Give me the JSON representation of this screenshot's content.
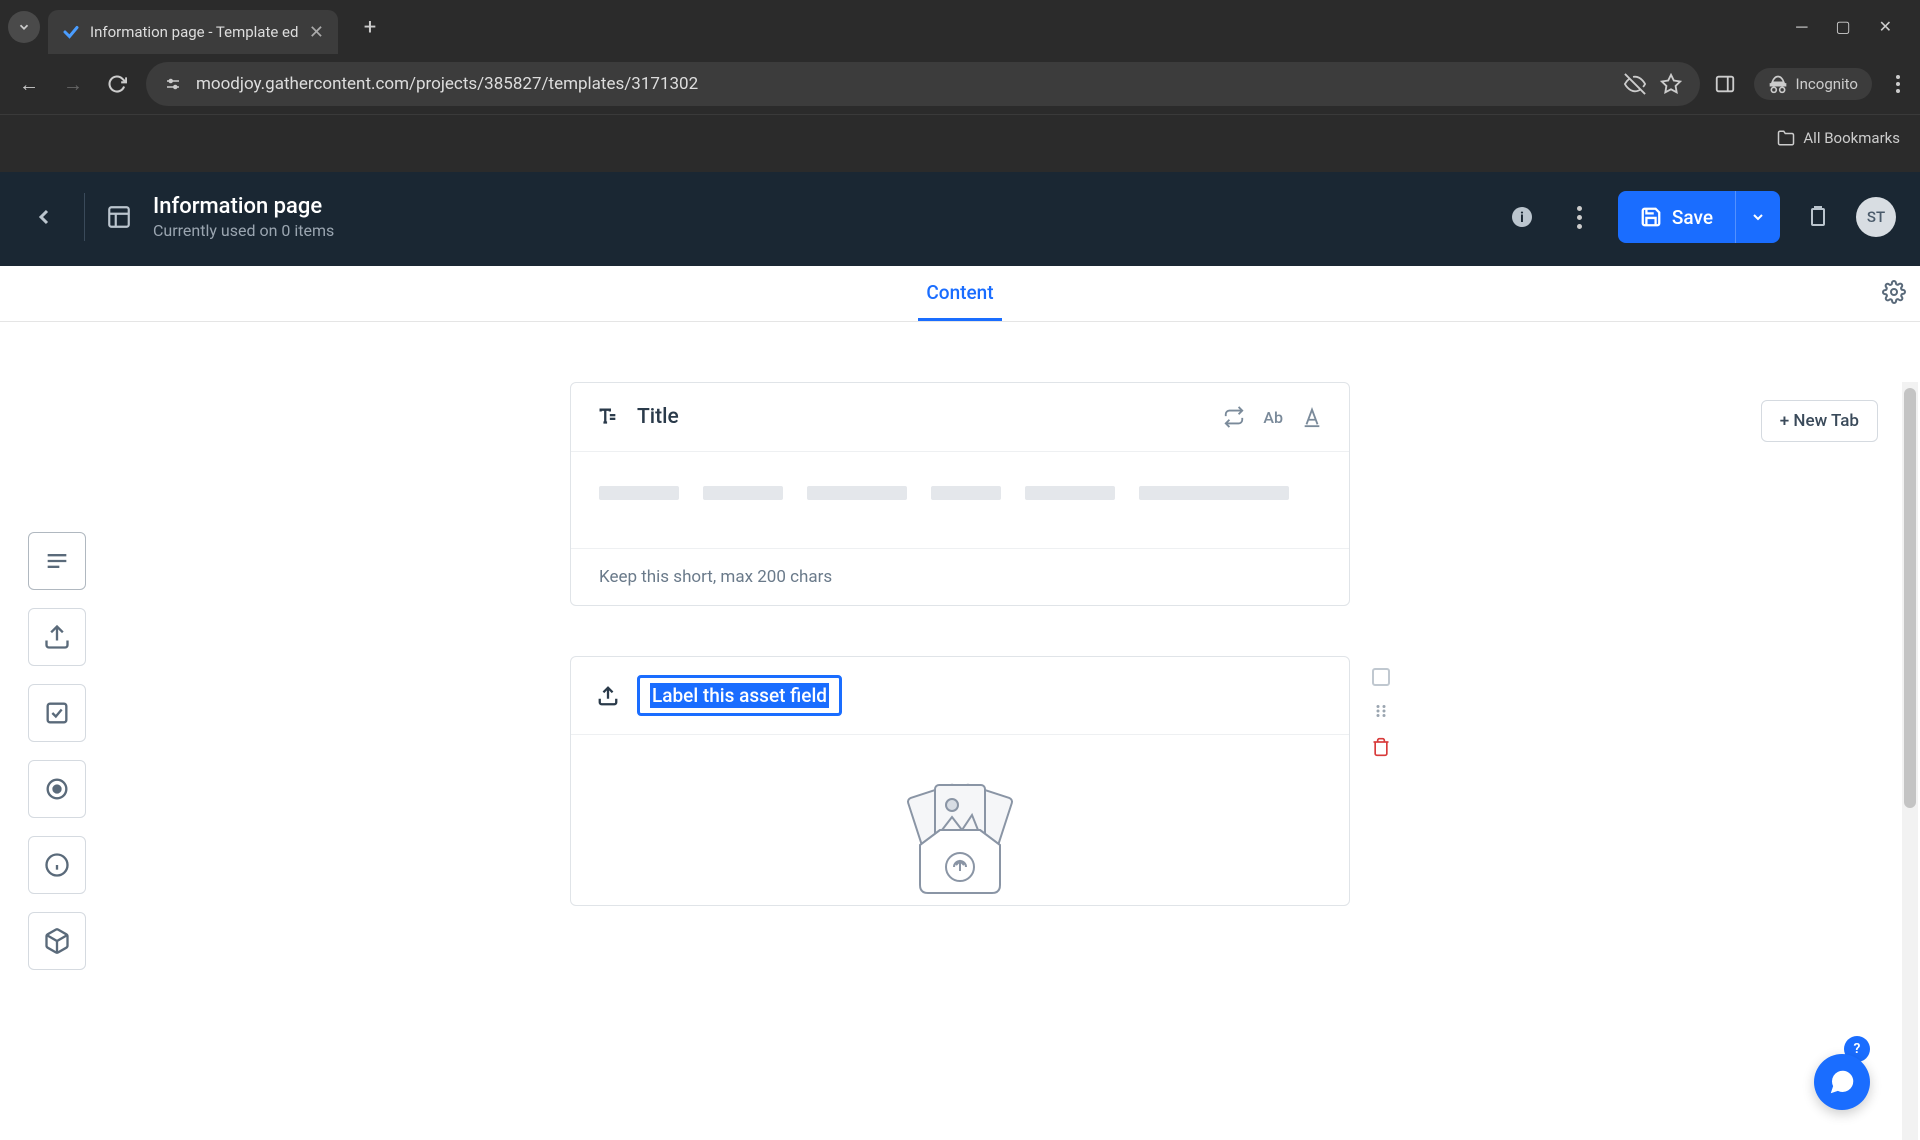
{
  "browser": {
    "tab_title": "Information page - Template ed",
    "url": "moodjoy.gathercontent.com/projects/385827/templates/3171302",
    "incognito_label": "Incognito",
    "all_bookmarks": "All Bookmarks"
  },
  "header": {
    "title": "Information page",
    "subtitle": "Currently used on 0 items",
    "save_label": "Save",
    "avatar_initials": "ST"
  },
  "tabs": {
    "active": "Content",
    "new_tab_label": "+ New Tab"
  },
  "fields": {
    "title_field": {
      "label": "Title",
      "toolbar_ab": "Ab",
      "hint": "Keep this short, max 200 chars"
    },
    "asset_field": {
      "placeholder": "Label this asset field"
    }
  },
  "help": {
    "icon": "?"
  }
}
